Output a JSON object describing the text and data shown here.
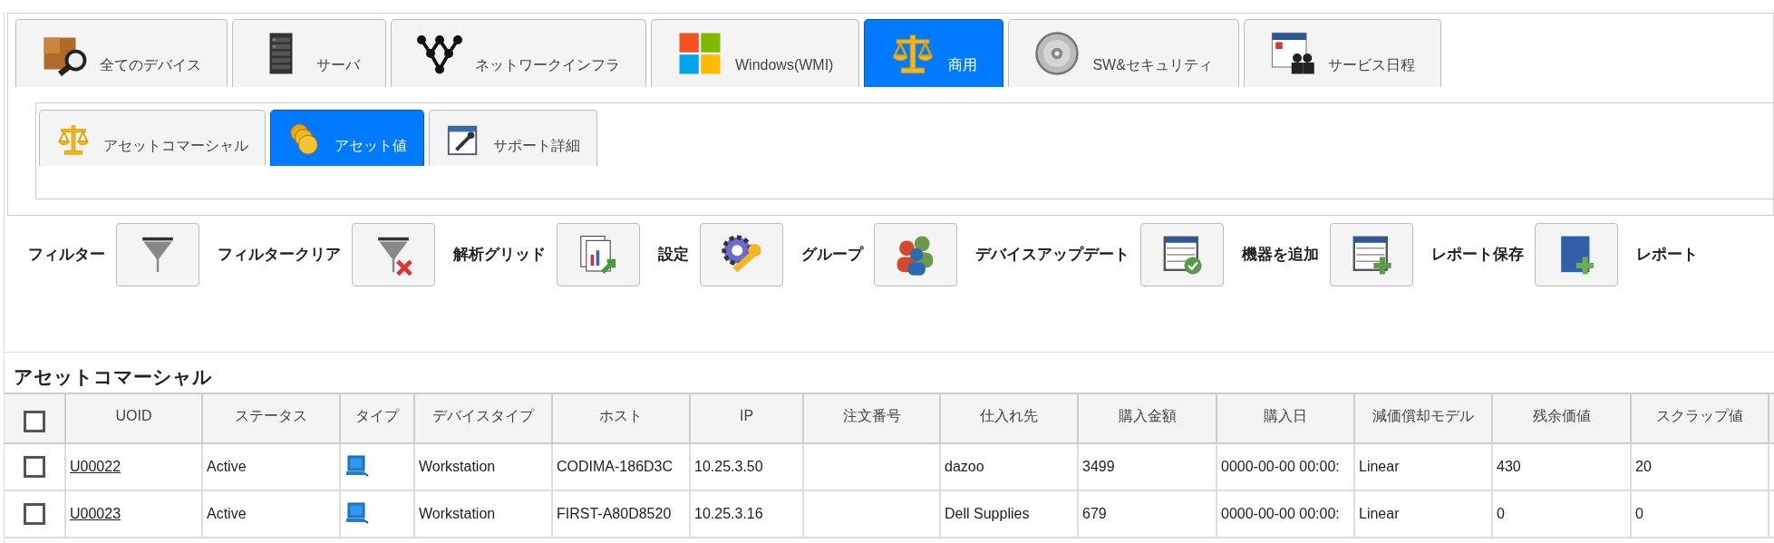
{
  "tabs": [
    {
      "label": "全てのデバイス",
      "selected": false
    },
    {
      "label": "サーバ",
      "selected": false
    },
    {
      "label": "ネットワークインフラ",
      "selected": false
    },
    {
      "label": "Windows(WMI)",
      "selected": false
    },
    {
      "label": "商用",
      "selected": true
    },
    {
      "label": "SW&セキュリティ",
      "selected": false
    },
    {
      "label": "サービス日程",
      "selected": false
    }
  ],
  "subtabs": [
    {
      "label": "アセットコマーシャル",
      "selected": false
    },
    {
      "label": "アセット値",
      "selected": true
    },
    {
      "label": "サポート詳細",
      "selected": false
    }
  ],
  "toolbar": [
    {
      "label": "フィルター"
    },
    {
      "label": "フィルタークリア"
    },
    {
      "label": "解析グリッド"
    },
    {
      "label": "設定"
    },
    {
      "label": "グループ"
    },
    {
      "label": "デバイスアップデート"
    },
    {
      "label": "機器を追加"
    },
    {
      "label": "レポート保存"
    },
    {
      "label": "レポート"
    }
  ],
  "table": {
    "title": "アセットコマーシャル",
    "header_checked": false,
    "columns": [
      "UOID",
      "ステータス",
      "タイプ",
      "デバイスタイプ",
      "ホスト",
      "IP",
      "注文番号",
      "仕入れ先",
      "購入金額",
      "購入日",
      "減価償却モデル",
      "残余価値",
      "スクラップ値"
    ],
    "rows": [
      {
        "checked": false,
        "cells": [
          {
            "kind": "link",
            "text": "U00022"
          },
          {
            "kind": "text",
            "text": "Active"
          },
          {
            "kind": "icon"
          },
          {
            "kind": "text",
            "text": "Workstation"
          },
          {
            "kind": "text",
            "text": "CODIMA-186D3C"
          },
          {
            "kind": "text",
            "text": "10.25.3.50"
          },
          {
            "kind": "empty"
          },
          {
            "kind": "text",
            "text": "dazoo"
          },
          {
            "kind": "text",
            "text": "3499"
          },
          {
            "kind": "text",
            "text": "0000-00-00 00:00:"
          },
          {
            "kind": "text",
            "text": "Linear"
          },
          {
            "kind": "text",
            "text": "430"
          },
          {
            "kind": "text",
            "text": "20"
          }
        ]
      },
      {
        "checked": false,
        "cells": [
          {
            "kind": "link",
            "text": "U00023"
          },
          {
            "kind": "text",
            "text": "Active"
          },
          {
            "kind": "icon"
          },
          {
            "kind": "text",
            "text": "Workstation"
          },
          {
            "kind": "text",
            "text": "FIRST-A80D8520"
          },
          {
            "kind": "text",
            "text": "10.25.3.16"
          },
          {
            "kind": "empty"
          },
          {
            "kind": "text",
            "text": "Dell Supplies"
          },
          {
            "kind": "text",
            "text": "679"
          },
          {
            "kind": "text",
            "text": "0000-00-00 00:00:"
          },
          {
            "kind": "text",
            "text": "Linear"
          },
          {
            "kind": "text",
            "text": "0"
          },
          {
            "kind": "text",
            "text": "0"
          }
        ]
      }
    ]
  }
}
